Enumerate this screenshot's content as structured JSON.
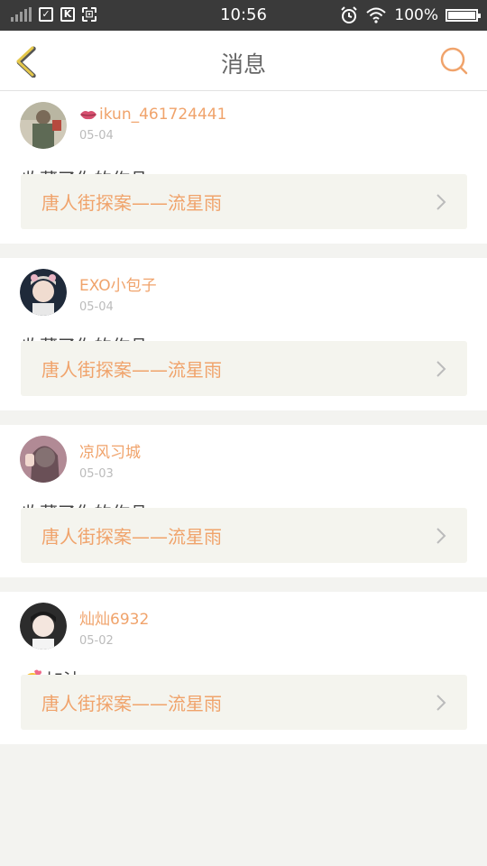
{
  "status_bar": {
    "time": "10:56",
    "battery": "100%"
  },
  "header": {
    "title": "消息",
    "back_icon": "chevron-left-icon",
    "search_icon": "search-icon"
  },
  "colors": {
    "accent": "#f0a36b",
    "back": "#e4c74a",
    "card_bg": "#f4f4ee"
  },
  "messages": [
    {
      "username": "ikun_461724441",
      "date": "05-04",
      "text": "收藏了你的作品",
      "work": "唐人街探案——流星雨",
      "badge": "lips-icon"
    },
    {
      "username": "EXO小包子",
      "date": "05-04",
      "text": "收藏了你的作品",
      "work": "唐人街探案——流星雨"
    },
    {
      "username": "凉风习城",
      "date": "05-03",
      "text": "收藏了你的作品",
      "work": "唐人街探案——流星雨"
    },
    {
      "username": "灿灿6932",
      "date": "05-02",
      "text": "加油",
      "work": "唐人街探案——流星雨",
      "emoji": "cheering-emoji"
    }
  ]
}
